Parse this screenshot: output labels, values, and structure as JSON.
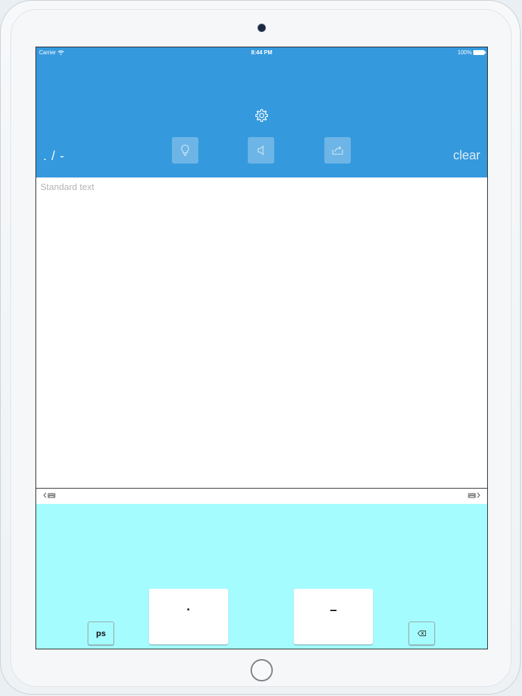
{
  "status_bar": {
    "carrier": "Carrier",
    "time": "8:44 PM",
    "battery": "100%"
  },
  "header": {
    "mode_label": ". / -",
    "clear_label": "clear",
    "icons": [
      "gear-icon",
      "lightbulb-icon",
      "speaker-icon",
      "share-icon"
    ]
  },
  "text_area": {
    "placeholder": "Standard text",
    "value": ""
  },
  "keyboard_toolbar": {
    "icons": [
      "chevron-left-icon",
      "keyboard-icon",
      "keyboard-icon",
      "chevron-right-icon"
    ]
  },
  "keyboard": {
    "ps_label": "ps",
    "dot_label": "·",
    "dash_label": "–",
    "backspace_icon": "backspace-icon"
  },
  "colors": {
    "header_bg": "#3599dd",
    "keyboard_bg": "#a5fcff",
    "screen_bg": "#ffffff"
  }
}
